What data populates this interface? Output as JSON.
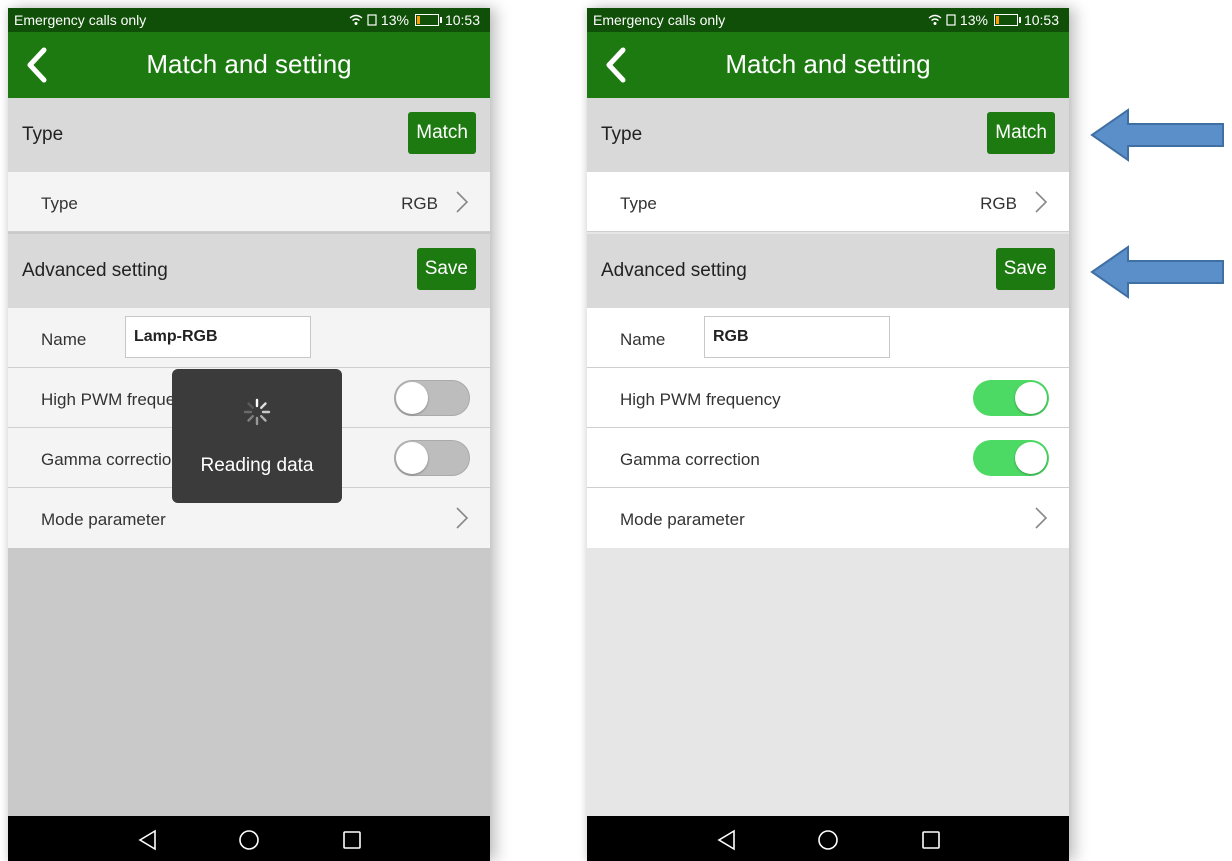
{
  "left_screen": {
    "status": {
      "carrier": "Emergency calls only",
      "battery": "13%",
      "time": "10:53"
    },
    "title": "Match and setting",
    "type_section": {
      "label": "Type",
      "button": "Match"
    },
    "type_row": {
      "label": "Type",
      "value": "RGB"
    },
    "advanced_section": {
      "label": "Advanced setting",
      "button": "Save"
    },
    "name_row": {
      "label": "Name",
      "value": "Lamp-RGB"
    },
    "pwm_row": {
      "label": "High PWM frequency",
      "enabled": false
    },
    "gamma_row": {
      "label": "Gamma correction",
      "enabled": false
    },
    "mode_row": {
      "label": "Mode parameter"
    },
    "toast": {
      "message": "Reading data"
    }
  },
  "right_screen": {
    "status": {
      "carrier": "Emergency calls only",
      "battery": "13%",
      "time": "10:53"
    },
    "title": "Match and setting",
    "type_section": {
      "label": "Type",
      "button": "Match"
    },
    "type_row": {
      "label": "Type",
      "value": "RGB"
    },
    "advanced_section": {
      "label": "Advanced setting",
      "button": "Save"
    },
    "name_row": {
      "label": "Name",
      "value": "RGB"
    },
    "pwm_row": {
      "label": "High PWM frequency",
      "enabled": true
    },
    "gamma_row": {
      "label": "Gamma correction",
      "enabled": true
    },
    "mode_row": {
      "label": "Mode parameter"
    }
  },
  "colors": {
    "app_bar": "#1d7a11",
    "status_bar": "#0f4f07",
    "toggle_on": "#4cd964",
    "toggle_off": "#bdbdbd",
    "annotation_arrow": "#5b8fc9"
  },
  "icons": {
    "back": "chevron-left-icon",
    "row_chevron": "chevron-right-icon",
    "nav_back": "triangle-back-icon",
    "nav_home": "circle-home-icon",
    "nav_recents": "square-recents-icon",
    "loading": "spinner-icon",
    "annotation": "left-arrow-icon"
  }
}
